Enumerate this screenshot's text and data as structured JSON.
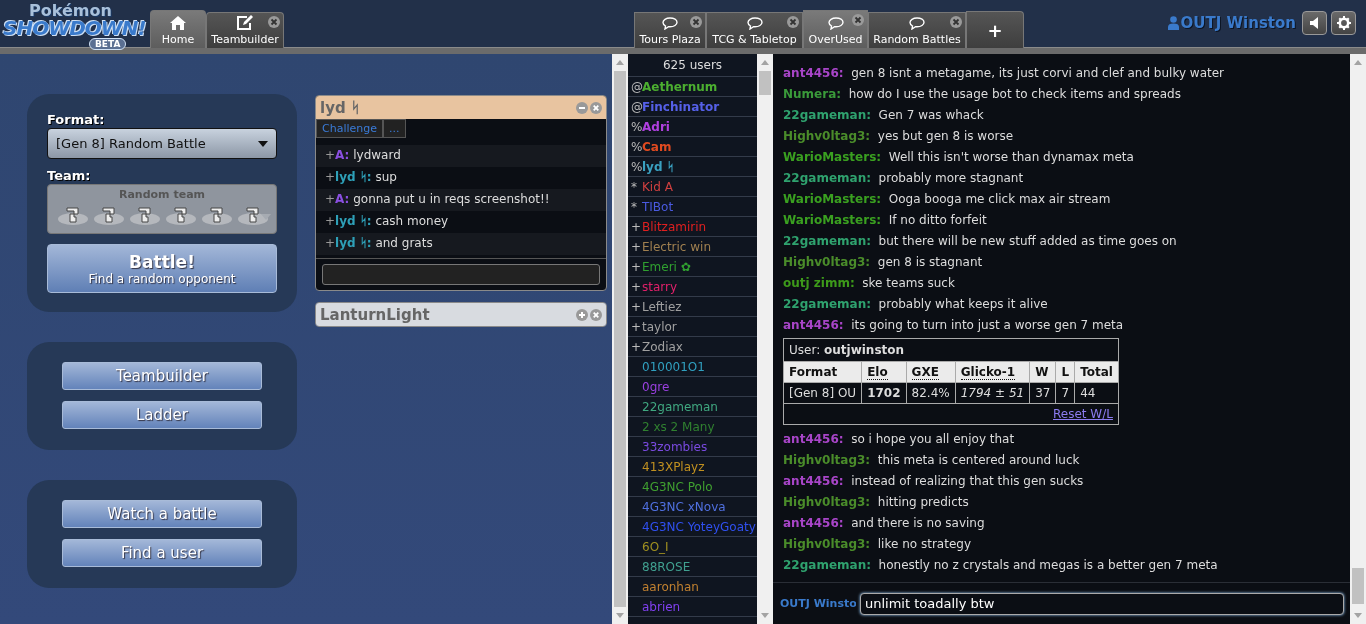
{
  "header": {
    "logo": {
      "title": "Pokémon",
      "name": "SHOWDOWN!",
      "badge": "BETA"
    },
    "left_tabs": [
      {
        "kind": "home",
        "label": "Home",
        "selected": true,
        "closable": false
      },
      {
        "kind": "builder",
        "label": "Teambuilder",
        "selected": false,
        "closable": true
      }
    ],
    "room_tabs": [
      {
        "label": "Tours Plaza",
        "selected": false
      },
      {
        "label": "TCG & Tabletop",
        "selected": false
      },
      {
        "label": "OverUsed",
        "selected": true
      },
      {
        "label": "Random Battles",
        "selected": false
      }
    ],
    "add_tab": "+",
    "user": "OUTJ Winston"
  },
  "home": {
    "format_label": "Format:",
    "format_value": "[Gen 8] Random Battle",
    "team_label": "Team:",
    "team_value": "Random team",
    "team_disabled": true,
    "battle_button": {
      "title": "Battle!",
      "subtitle": "Find a random opponent"
    },
    "button_groups": [
      [
        "Teambuilder",
        "Ladder"
      ],
      [
        "Watch a battle",
        "Find a user"
      ]
    ]
  },
  "pms": [
    {
      "title": "lyd ᛋ",
      "expanded": true,
      "tabs": [
        "Challenge",
        "..."
      ],
      "messages": [
        {
          "rank": "+",
          "user": "A:",
          "color": "#8a4fe0",
          "text": "lydward"
        },
        {
          "rank": "+",
          "user": "lyd ᛋ:",
          "color": "#2ea0b8",
          "text": "sup"
        },
        {
          "rank": "+",
          "user": "A:",
          "color": "#8a4fe0",
          "text": "gonna put u in reqs screenshot!!"
        },
        {
          "rank": "+",
          "user": "lyd ᛋ:",
          "color": "#2ea0b8",
          "text": "cash money"
        },
        {
          "rank": "+",
          "user": "lyd ᛋ:",
          "color": "#2ea0b8",
          "text": "and grats"
        }
      ]
    },
    {
      "title": "LanturnLight",
      "expanded": false
    }
  ],
  "userlist": {
    "count": "625 users",
    "users": [
      {
        "rank": "@",
        "name": "Aethernum",
        "color": "#4caf30",
        "staff": true
      },
      {
        "rank": "@",
        "name": "Finchinator",
        "color": "#5560e8",
        "staff": true
      },
      {
        "rank": "%",
        "name": "Adri",
        "color": "#b040e0",
        "staff": true
      },
      {
        "rank": "%",
        "name": "Cam",
        "color": "#e04a20",
        "staff": true
      },
      {
        "rank": "%",
        "name": "lyd ᛋ",
        "color": "#3aa0c0",
        "staff": true
      },
      {
        "rank": "*",
        "name": "Kid A",
        "color": "#d04040",
        "staff": false
      },
      {
        "rank": "*",
        "name": "TIBot",
        "color": "#4a5ae0",
        "staff": false
      },
      {
        "rank": "+",
        "name": "Blitzamirin",
        "color": "#e02020",
        "staff": false
      },
      {
        "rank": "+",
        "name": "Electric win",
        "color": "#a08050",
        "staff": false
      },
      {
        "rank": "+",
        "name": "Emeri ✿",
        "color": "#30a030",
        "staff": false
      },
      {
        "rank": "+",
        "name": "starry",
        "color": "#e0206a",
        "staff": false
      },
      {
        "rank": "+",
        "name": "Leftiez",
        "color": "#a0a0a0",
        "staff": false
      },
      {
        "rank": "+",
        "name": "taylor",
        "color": "#a0a0a0",
        "staff": false
      },
      {
        "rank": "+",
        "name": "Zodiax",
        "color": "#a0a0a0",
        "staff": false
      },
      {
        "name": "010001O1",
        "color": "#30a0c0",
        "staff": false
      },
      {
        "name": "0gre",
        "color": "#9a40e0",
        "staff": false
      },
      {
        "name": "22gameman",
        "color": "#40a880",
        "staff": false
      },
      {
        "name": "2 xs 2 Many",
        "color": "#308030",
        "staff": false
      },
      {
        "name": "33zombies",
        "color": "#7a4ae0",
        "staff": false
      },
      {
        "name": "413XPlayz",
        "color": "#c09020",
        "staff": false
      },
      {
        "name": "4G3NC Polo",
        "color": "#40a030",
        "staff": false
      },
      {
        "name": "4G3NC xNova",
        "color": "#5070e0",
        "staff": false
      },
      {
        "name": "4G3NC YoteyGoaty",
        "color": "#3050f0",
        "staff": false
      },
      {
        "name": "6O_I",
        "color": "#a09020",
        "staff": false
      },
      {
        "name": "88ROSE",
        "color": "#40a090",
        "staff": false
      },
      {
        "name": "aaronhan",
        "color": "#c08030",
        "staff": false
      },
      {
        "name": "abrien",
        "color": "#8040f0",
        "staff": false
      }
    ]
  },
  "chat": {
    "messages": [
      {
        "kind": "chat",
        "user": "ant4456:",
        "color": "#a845c8",
        "text": "gen 8 isnt a metagame, its just corvi and clef and bulky water"
      },
      {
        "kind": "chat",
        "user": "Numera:",
        "color": "#3a9a3a",
        "text": "how do I use the usage bot to check items and spreads"
      },
      {
        "kind": "chat",
        "user": "22gameman:",
        "color": "#2fa26e",
        "text": "Gen 7 was whack"
      },
      {
        "kind": "chat",
        "user": "Highv0ltag3:",
        "color": "#4a8c2a",
        "text": "yes but gen 8 is worse"
      },
      {
        "kind": "chat",
        "user": "WarioMasters:",
        "color": "#3aa020",
        "text": "Well this isn't worse than dynamax meta"
      },
      {
        "kind": "chat",
        "user": "22gameman:",
        "color": "#2fa26e",
        "text": "probably more stagnant"
      },
      {
        "kind": "chat",
        "user": "WarioMasters:",
        "color": "#3aa020",
        "text": "Ooga booga me click max air stream"
      },
      {
        "kind": "chat",
        "user": "WarioMasters:",
        "color": "#3aa020",
        "text": "If no ditto forfeit"
      },
      {
        "kind": "chat",
        "user": "22gameman:",
        "color": "#2fa26e",
        "text": "but there will be new stuff added as time goes on"
      },
      {
        "kind": "chat",
        "user": "Highv0ltag3:",
        "color": "#4a8c2a",
        "text": "gen 8 is stagnant"
      },
      {
        "kind": "chat",
        "user": "outj zimm:",
        "color": "#3d9a1a",
        "text": "ske teams suck"
      },
      {
        "kind": "chat",
        "user": "22gameman:",
        "color": "#2fa26e",
        "text": "probably what keeps it alive"
      },
      {
        "kind": "chat",
        "user": "ant4456:",
        "color": "#a845c8",
        "text": "its going to turn into just a worse gen 7 meta"
      },
      {
        "kind": "ratings",
        "title": "User: **outjwinston**",
        "columns": [
          "Format",
          "Elo",
          "GXE",
          "Glicko-1",
          "W",
          "L",
          "Total"
        ],
        "row": [
          "[Gen 8] OU",
          "1702",
          "82.4%",
          "1794 ± 51",
          "37",
          "7",
          "44"
        ],
        "link": "Reset W/L"
      },
      {
        "kind": "chat",
        "user": "ant4456:",
        "color": "#a845c8",
        "text": "so i hope you all enjoy that"
      },
      {
        "kind": "chat",
        "user": "Highv0ltag3:",
        "color": "#4a8c2a",
        "text": "this meta is centered around luck"
      },
      {
        "kind": "chat",
        "user": "ant4456:",
        "color": "#a845c8",
        "text": "instead of realizing that this gen sucks"
      },
      {
        "kind": "chat",
        "user": "Highv0ltag3:",
        "color": "#4a8c2a",
        "text": "hitting predicts"
      },
      {
        "kind": "chat",
        "user": "ant4456:",
        "color": "#a845c8",
        "text": "and there is no saving"
      },
      {
        "kind": "chat",
        "user": "Highv0ltag3:",
        "color": "#4a8c2a",
        "text": "like no strategy"
      },
      {
        "kind": "chat",
        "user": "22gameman:",
        "color": "#2fa26e",
        "text": "honestly no z crystals and megas is a better gen 7 meta"
      }
    ],
    "input_name": "OUTJ Winsto",
    "input_value": "unlimit toadally btw"
  }
}
